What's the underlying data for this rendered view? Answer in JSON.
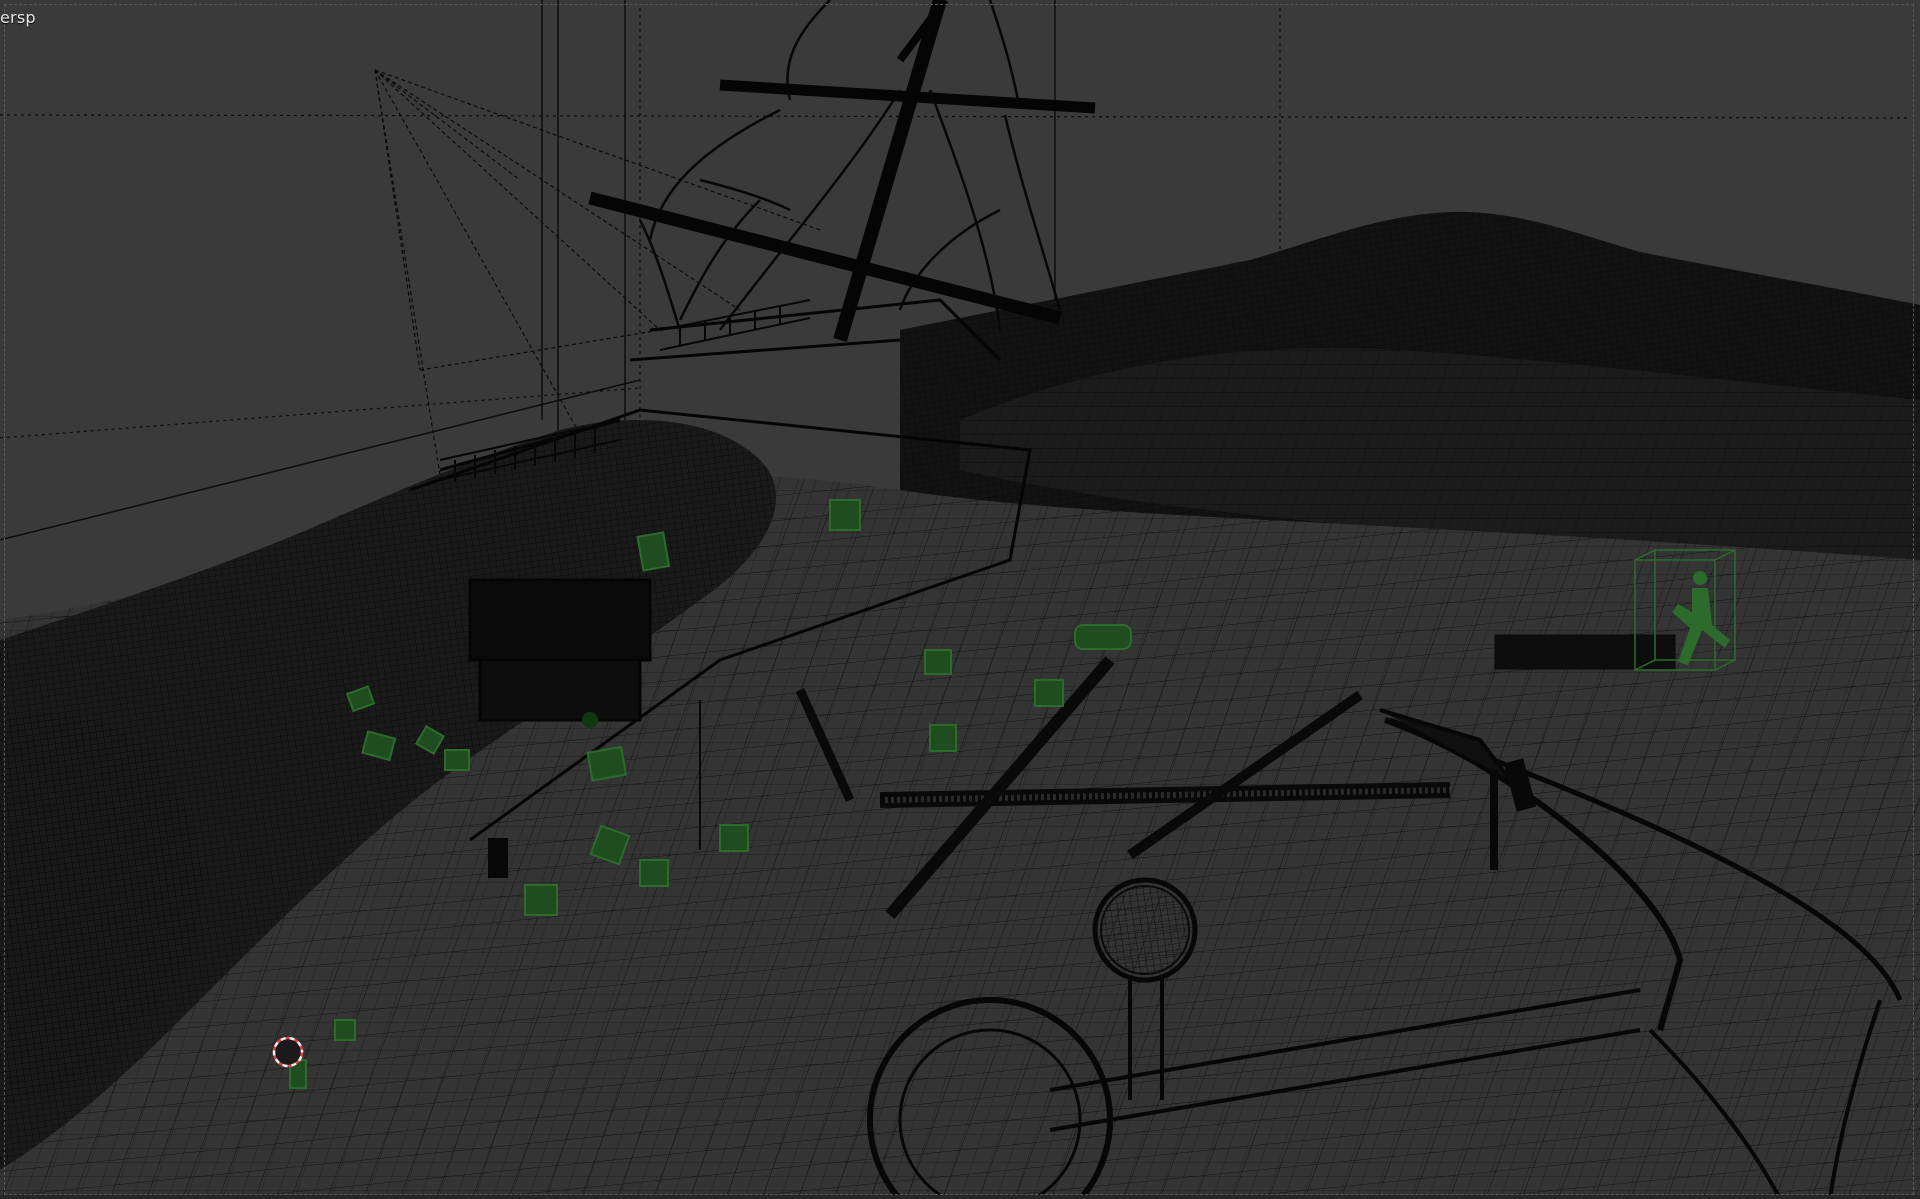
{
  "viewport": {
    "view_label": "ersp",
    "colors": {
      "background": "#3a3a3a",
      "wire": "#0a0a0a",
      "selected": "#2c6b2c",
      "grid": "#555555",
      "axis_x": "#8a2a2a",
      "cursor": "#e04040"
    },
    "icons": [
      "3d-cursor-icon",
      "camera-icon"
    ]
  }
}
